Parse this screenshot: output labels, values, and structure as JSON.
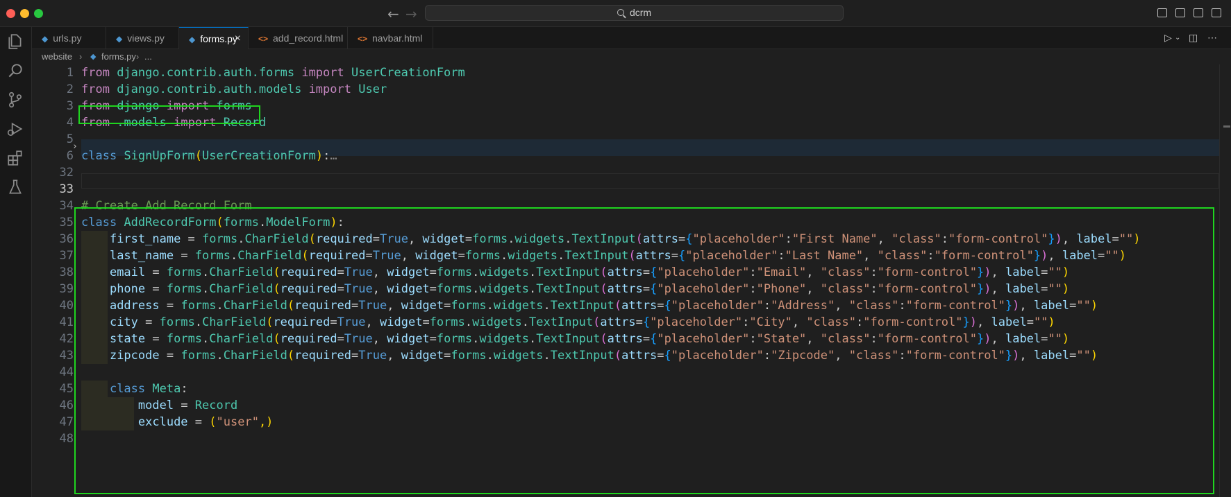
{
  "window": {
    "title": "dcrm"
  },
  "tabs": [
    {
      "label": "urls.py",
      "type": "py"
    },
    {
      "label": "views.py",
      "type": "py"
    },
    {
      "label": "forms.py",
      "type": "py",
      "active": true
    },
    {
      "label": "add_record.html",
      "type": "html"
    },
    {
      "label": "navbar.html",
      "type": "html"
    }
  ],
  "breadcrumb": {
    "folder": "website",
    "file": "forms.py",
    "more": "..."
  },
  "icons": {
    "python_file": "◆",
    "html_file": "<>",
    "close": "×",
    "fold_collapsed": "›",
    "ellipsis": "…"
  },
  "line_numbers": [
    "1",
    "2",
    "3",
    "4",
    "5",
    "6",
    "32",
    "33",
    "34",
    "35",
    "36",
    "37",
    "38",
    "39",
    "40",
    "41",
    "42",
    "43",
    "44",
    "45",
    "46",
    "47",
    "48"
  ],
  "code": {
    "l1": [
      "from",
      "django.contrib.auth.forms",
      "import",
      "UserCreationForm"
    ],
    "l2": [
      "from",
      "django.contrib.auth.models",
      "import",
      "User"
    ],
    "l3": [
      "from",
      "django",
      "import",
      "forms"
    ],
    "l4": [
      "from",
      ".models",
      "import",
      "Record"
    ],
    "l6": [
      "class",
      "SignUpForm",
      "(",
      "UserCreationForm",
      ")",
      ":"
    ],
    "l34": "# Create Add Record Form",
    "l35": [
      "class",
      "AddRecordForm",
      "(",
      "forms",
      ".",
      "ModelForm",
      ")",
      ":"
    ],
    "fields": [
      {
        "name": "first_name",
        "placeholder": "\"First Name\""
      },
      {
        "name": "last_name",
        "placeholder": "\"Last Name\""
      },
      {
        "name": "email",
        "placeholder": "\"Email\""
      },
      {
        "name": "phone",
        "placeholder": "\"Phone\""
      },
      {
        "name": "address",
        "placeholder": "\"Address\""
      },
      {
        "name": "city",
        "placeholder": "\"City\""
      },
      {
        "name": "state",
        "placeholder": "\"State\""
      },
      {
        "name": "zipcode",
        "placeholder": "\"Zipcode\""
      }
    ],
    "field_parts": {
      "eq": " = ",
      "forms": "forms",
      "dot": ".",
      "charfield": "CharField",
      "required": "required",
      "true": "True",
      "widget": "widget",
      "widgets": "widgets",
      "textinput": "TextInput",
      "attrs": "attrs",
      "ph_key": "\"placeholder\"",
      "class_key": "\"class\"",
      "class_val": "\"form-control\"",
      "label": "label",
      "empty": "\"\""
    },
    "l45": [
      "class",
      "Meta",
      ":"
    ],
    "l46": [
      "model",
      " = ",
      "Record"
    ],
    "l47": [
      "exclude",
      " = ",
      "(",
      "\"user\"",
      ",)"
    ]
  },
  "colors": {
    "highlight_box": "#1fd51f",
    "accent": "#0078d4"
  }
}
